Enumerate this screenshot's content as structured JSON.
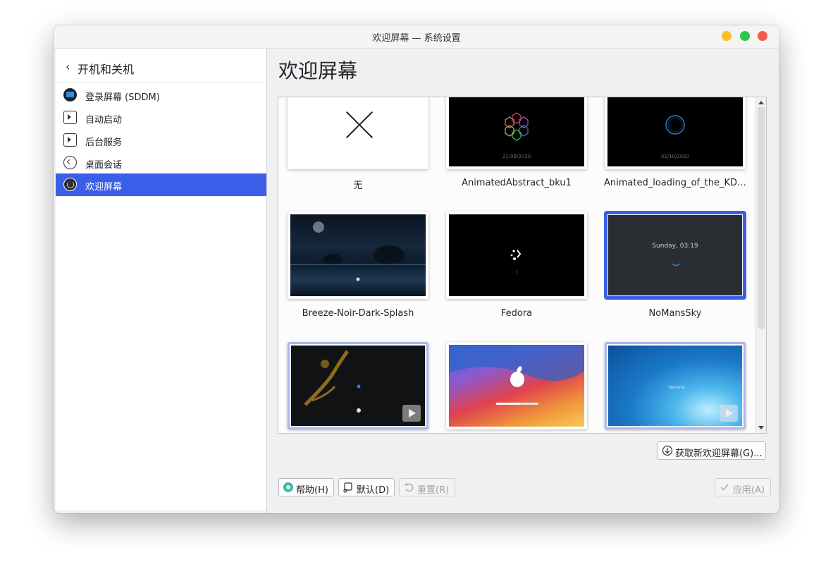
{
  "window": {
    "title": "欢迎屏幕 — 系统设置"
  },
  "sidebar": {
    "back_label": "开机和关机",
    "items": [
      {
        "label": "登录屏幕 (SDDM)",
        "icon": "login-screen-icon"
      },
      {
        "label": "自动启动",
        "icon": "autostart-icon"
      },
      {
        "label": "后台服务",
        "icon": "background-services-icon"
      },
      {
        "label": "桌面会话",
        "icon": "desktop-session-icon"
      },
      {
        "label": "欢迎屏幕",
        "icon": "splash-screen-icon",
        "active": true
      }
    ]
  },
  "main": {
    "title": "欢迎屏幕",
    "themes": [
      {
        "name": "无"
      },
      {
        "name": "AnimatedAbstract_bku1",
        "date": "21/09/2020"
      },
      {
        "name": "Animated_loading_of_the_KD…",
        "date": "02/10/2020"
      },
      {
        "name": "Breeze-Noir-Dark-Splash"
      },
      {
        "name": "Fedora",
        "counter": "3"
      },
      {
        "name": "NoMansSky",
        "clock": "Sunday, 03:19",
        "selected": true
      },
      {
        "name": ""
      },
      {
        "name": ""
      },
      {
        "name": "",
        "preview_text": "Welcome"
      }
    ],
    "get_new_label": "获取新欢迎屏幕(G)..."
  },
  "footer": {
    "help_label": "帮助(H)",
    "defaults_label": "默认(D)",
    "reset_label": "重置(R)",
    "apply_label": "应用(A)"
  },
  "colors": {
    "accent": "#3a5ee8",
    "sidebar_active": "#3a5ee8"
  }
}
